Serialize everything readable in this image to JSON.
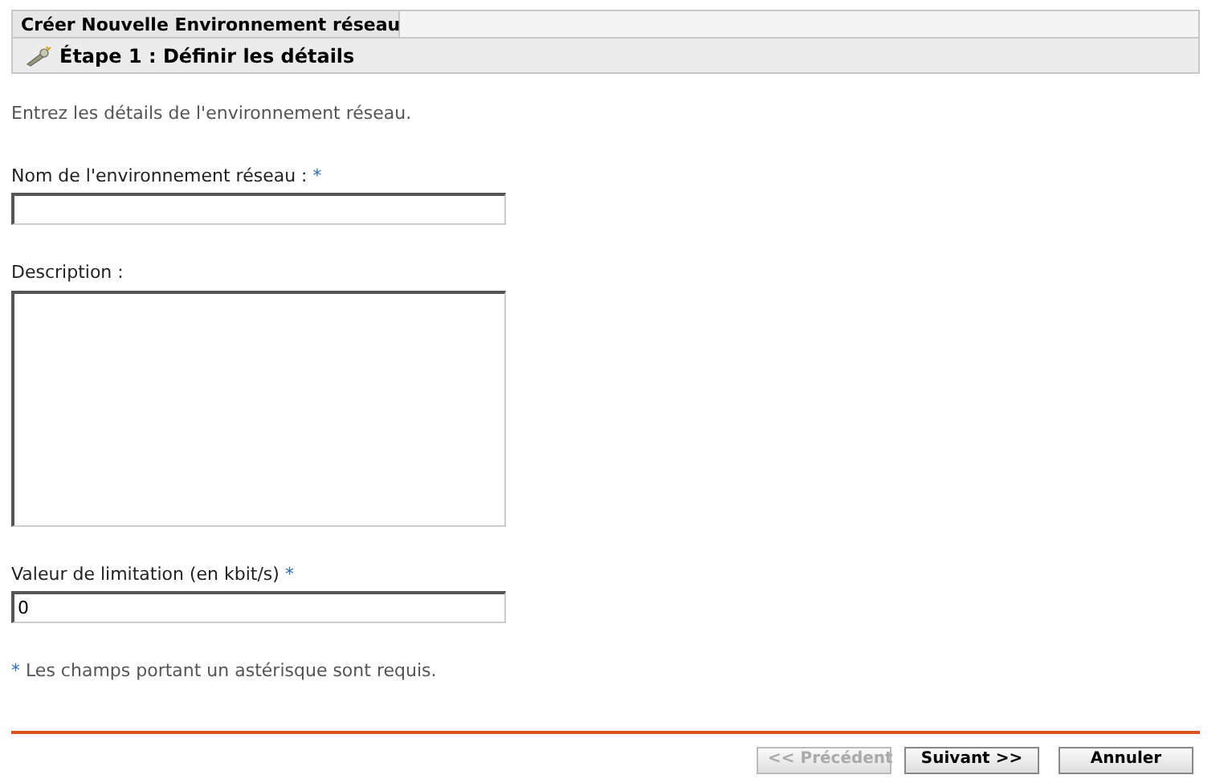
{
  "header": {
    "title": "Créer Nouvelle Environnement réseau",
    "step": "Étape 1 : Définir les détails"
  },
  "intro": "Entrez les détails de l'environnement réseau.",
  "fields": [
    {
      "kind": "text",
      "label": "Nom de l'environnement réseau :",
      "required_mark": "*"
    },
    {
      "kind": "textarea",
      "label": "Description :"
    },
    {
      "kind": "text",
      "label": "Valeur de limitation (en kbit/s)",
      "required_mark": "*",
      "value": "0"
    }
  ],
  "note": {
    "mark": "*",
    "text": "Les champs portant un astérisque sont requis."
  },
  "buttons": [
    {
      "label": "<< Précédent",
      "disabled": true
    },
    {
      "label": "Suivant >>",
      "disabled": false
    },
    {
      "label": "Annuler",
      "disabled": false
    }
  ]
}
